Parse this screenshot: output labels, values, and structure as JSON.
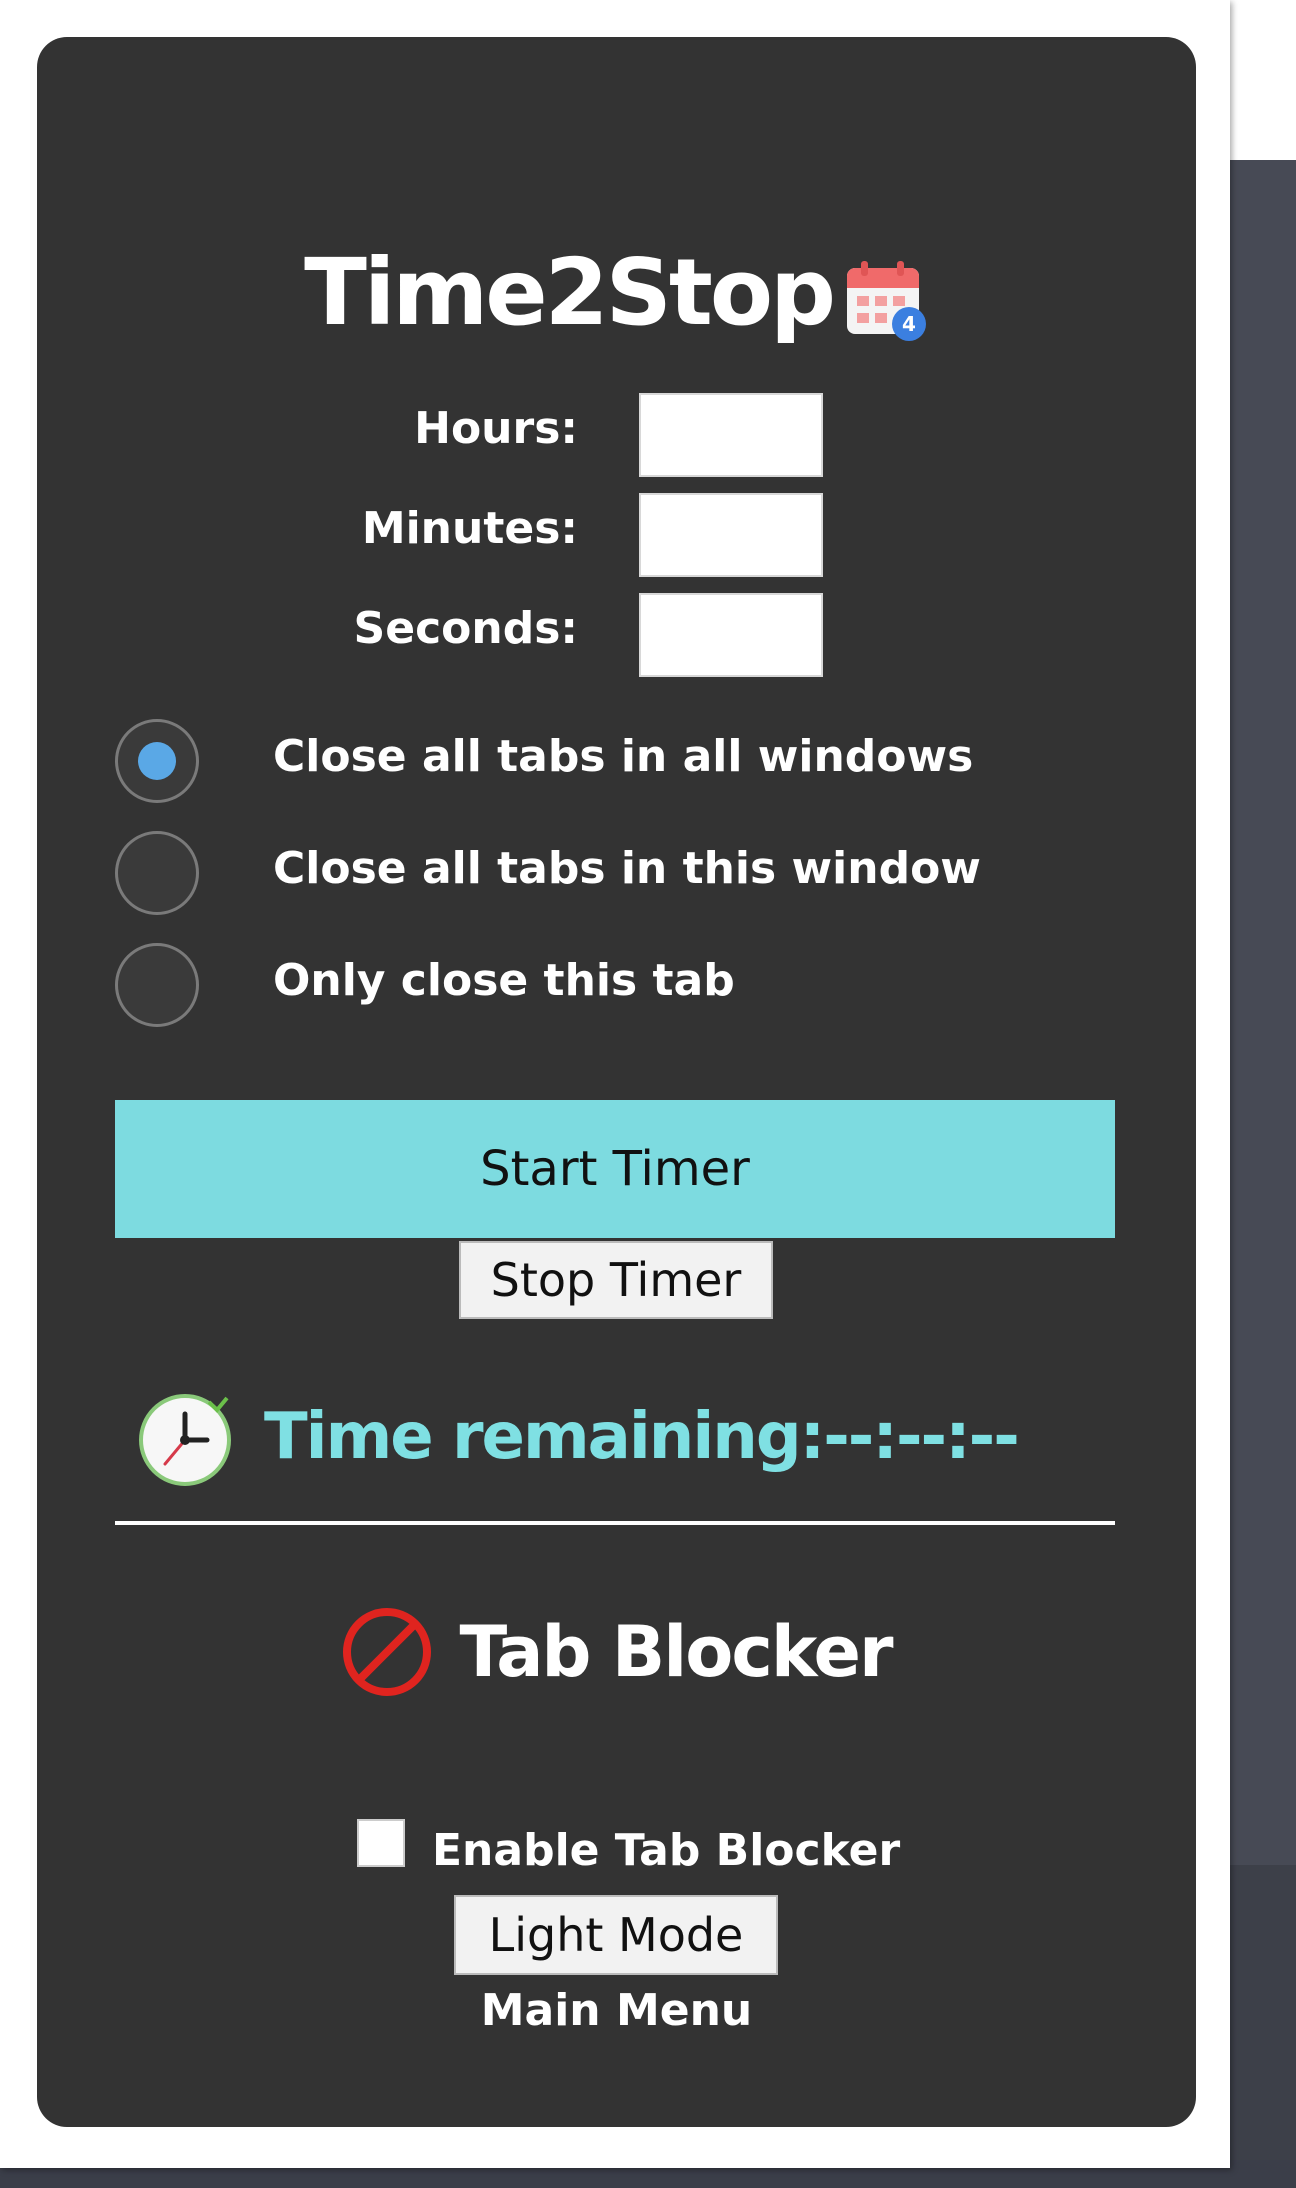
{
  "app": {
    "title": "Time2Stop",
    "title_icon": "calendar-icon"
  },
  "fields": [
    {
      "label": "Hours:",
      "value": ""
    },
    {
      "label": "Minutes:",
      "value": ""
    },
    {
      "label": "Seconds:",
      "value": ""
    }
  ],
  "close_options": [
    {
      "label": "Close all tabs in all windows",
      "checked": true
    },
    {
      "label": "Close all tabs in this window",
      "checked": false
    },
    {
      "label": "Only close this tab",
      "checked": false
    }
  ],
  "buttons": {
    "start": "Start Timer",
    "stop": "Stop Timer",
    "light_mode": "Light Mode"
  },
  "timer": {
    "label": "Time remaining:--:--:--",
    "icon": "clock-icon"
  },
  "blocker": {
    "title": "Tab Blocker",
    "icon": "prohibited-icon",
    "enable_label": "Enable Tab Blocker",
    "enabled": false
  },
  "footer": {
    "main_menu": "Main Menu"
  },
  "colors": {
    "panel_bg": "#333333",
    "accent": "#7ddbe0",
    "radio_selected": "#5aa8e6",
    "blocker_red": "#e0241f"
  }
}
